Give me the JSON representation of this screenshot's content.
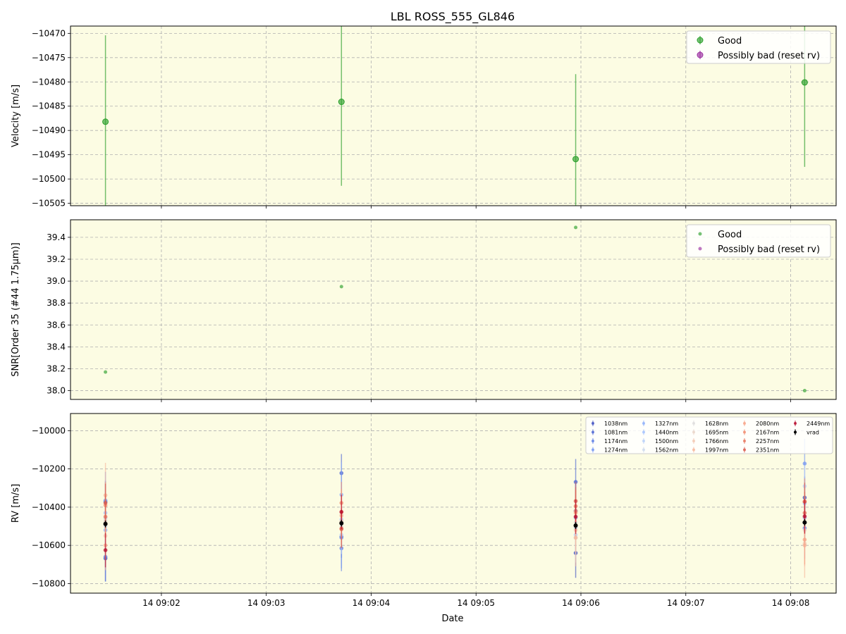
{
  "figure": {
    "title": "LBL ROSS_555_GL846",
    "xlabel": "Date"
  },
  "colors": {
    "panel_bg": "#fcfce3",
    "good": "#2ca02c",
    "bad": "#9b30a0",
    "vrad": "#000000",
    "grid": "#b0b0b0"
  },
  "chart_data": [
    {
      "type": "scatter",
      "panel": "velocity",
      "ylabel": "Velocity [m/s]",
      "ylim": [
        -10505.5,
        -10468.5
      ],
      "yticks": [
        -10470,
        -10475,
        -10480,
        -10485,
        -10490,
        -10495,
        -10500,
        -10505
      ],
      "ytick_labels": [
        "−10470",
        "−10475",
        "−10480",
        "−10485",
        "−10490",
        "−10495",
        "−10500",
        "−10505"
      ],
      "grid": true,
      "legend": {
        "placement": "top-right",
        "entries": [
          "Good",
          "Possibly bad (reset rv)"
        ]
      },
      "series": [
        {
          "name": "Good",
          "x": [
            "14 09:01:28",
            "14 09:03:43",
            "14 09:05:57",
            "14 09:08:08"
          ],
          "y": [
            -10488.2,
            -10484.1,
            -10495.9,
            -10480.1
          ],
          "yerr": [
            17.8,
            17.3,
            17.5,
            17.4
          ]
        },
        {
          "name": "Possibly bad (reset rv)",
          "x": [],
          "y": [],
          "yerr": []
        }
      ]
    },
    {
      "type": "scatter",
      "panel": "snr",
      "ylabel": "SNR[Order 35 (#44 1.75μm)]",
      "ylim": [
        37.92,
        39.56
      ],
      "yticks": [
        38.0,
        38.2,
        38.4,
        38.6,
        38.8,
        39.0,
        39.2,
        39.4
      ],
      "ytick_labels": [
        "38.0",
        "38.2",
        "38.4",
        "38.6",
        "38.8",
        "39.0",
        "39.2",
        "39.4"
      ],
      "grid": true,
      "legend": {
        "placement": "top-right",
        "entries": [
          "Good",
          "Possibly bad (reset rv)"
        ]
      },
      "series": [
        {
          "name": "Good",
          "x": [
            "14 09:01:28",
            "14 09:03:43",
            "14 09:05:57",
            "14 09:08:08"
          ],
          "y": [
            38.17,
            38.95,
            39.49,
            38.0
          ]
        },
        {
          "name": "Possibly bad (reset rv)",
          "x": [],
          "y": []
        }
      ]
    },
    {
      "type": "scatter",
      "panel": "rv",
      "ylabel": "RV [m/s]",
      "ylim": [
        -10850,
        -9910
      ],
      "yticks": [
        -10000,
        -10200,
        -10400,
        -10600,
        -10800
      ],
      "ytick_labels": [
        "−10000",
        "−10200",
        "−10400",
        "−10600",
        "−10800"
      ],
      "grid": true,
      "legend": {
        "placement": "top-right",
        "columns": 5
      },
      "x": [
        "14 09:01:28",
        "14 09:03:43",
        "14 09:05:57",
        "14 09:08:08"
      ],
      "series": [
        {
          "name": "1038nm",
          "color": "#3b4cc0",
          "values": [
            -10668,
            -10555,
            -10640,
            -10350
          ],
          "err": [
            120,
            110,
            130,
            110
          ]
        },
        {
          "name": "1081nm",
          "color": "#4a63d3",
          "values": [
            -10372,
            -10222,
            -10268,
            -10510
          ],
          "err": [
            110,
            100,
            120,
            100
          ]
        },
        {
          "name": "1174nm",
          "color": "#5e7ee6",
          "values": [
            -10660,
            -10615,
            -10420,
            -10455
          ],
          "err": [
            130,
            120,
            150,
            120
          ]
        },
        {
          "name": "1274nm",
          "color": "#7496f2",
          "values": [
            -10365,
            -10560,
            -10420,
            -10172
          ],
          "err": [
            150,
            160,
            150,
            130
          ]
        },
        {
          "name": "1327nm",
          "color": "#8caffa",
          "values": [
            -10520,
            -10335,
            -10455,
            -10510
          ],
          "err": [
            160,
            170,
            170,
            160
          ]
        },
        {
          "name": "1440nm",
          "color": "#a3c2fe",
          "values": [
            -10430,
            -10465,
            -10505,
            -10380
          ],
          "err": [
            120,
            110,
            130,
            110
          ]
        },
        {
          "name": "1500nm",
          "color": "#b9d0f9",
          "values": [
            -10455,
            -10545,
            -10545,
            -10290
          ],
          "err": [
            110,
            100,
            120,
            110
          ]
        },
        {
          "name": "1562nm",
          "color": "#cdd9ec",
          "values": [
            -10500,
            -10470,
            -10560,
            -10455
          ],
          "err": [
            120,
            120,
            130,
            120
          ]
        },
        {
          "name": "1628nm",
          "color": "#dddcdc",
          "values": [
            -10470,
            -10500,
            -10480,
            -10430
          ],
          "err": [
            100,
            100,
            110,
            100
          ]
        },
        {
          "name": "1695nm",
          "color": "#ead4c8",
          "values": [
            -10480,
            -10440,
            -10500,
            -10520
          ],
          "err": [
            110,
            100,
            110,
            110
          ]
        },
        {
          "name": "1766nm",
          "color": "#f3c7b1",
          "values": [
            -10550,
            -10475,
            -10520,
            -10590
          ],
          "err": [
            120,
            110,
            120,
            120
          ]
        },
        {
          "name": "1997nm",
          "color": "#f7b599",
          "values": [
            -10338,
            -10445,
            -10560,
            -10600
          ],
          "err": [
            170,
            130,
            150,
            170
          ]
        },
        {
          "name": "2080nm",
          "color": "#f7a184",
          "values": [
            -10600,
            -10425,
            -10430,
            -10570
          ],
          "err": [
            130,
            120,
            120,
            130
          ]
        },
        {
          "name": "2167nm",
          "color": "#f18a6d",
          "values": [
            -10390,
            -10378,
            -10420,
            -10370
          ],
          "err": [
            120,
            110,
            110,
            120
          ]
        },
        {
          "name": "2257nm",
          "color": "#e7745b",
          "values": [
            -10450,
            -10515,
            -10395,
            -10430
          ],
          "err": [
            110,
            100,
            100,
            110
          ]
        },
        {
          "name": "2351nm",
          "color": "#d8574a",
          "values": [
            -10378,
            -10512,
            -10368,
            -10372
          ],
          "err": [
            100,
            100,
            100,
            100
          ]
        },
        {
          "name": "2449nm",
          "color": "#b40426",
          "values": [
            -10625,
            -10425,
            -10450,
            -10448
          ],
          "err": [
            90,
            90,
            90,
            90
          ]
        },
        {
          "name": "vrad",
          "color": "#000000",
          "values": [
            -10488,
            -10484,
            -10496,
            -10480
          ],
          "err": [
            18,
            17,
            18,
            17
          ]
        }
      ]
    }
  ],
  "xaxis": {
    "range": [
      "14 09:01:08",
      "14 09:08:26"
    ],
    "ticks": [
      "14 09:02",
      "14 09:03",
      "14 09:04",
      "14 09:05",
      "14 09:06",
      "14 09:07",
      "14 09:08"
    ]
  }
}
